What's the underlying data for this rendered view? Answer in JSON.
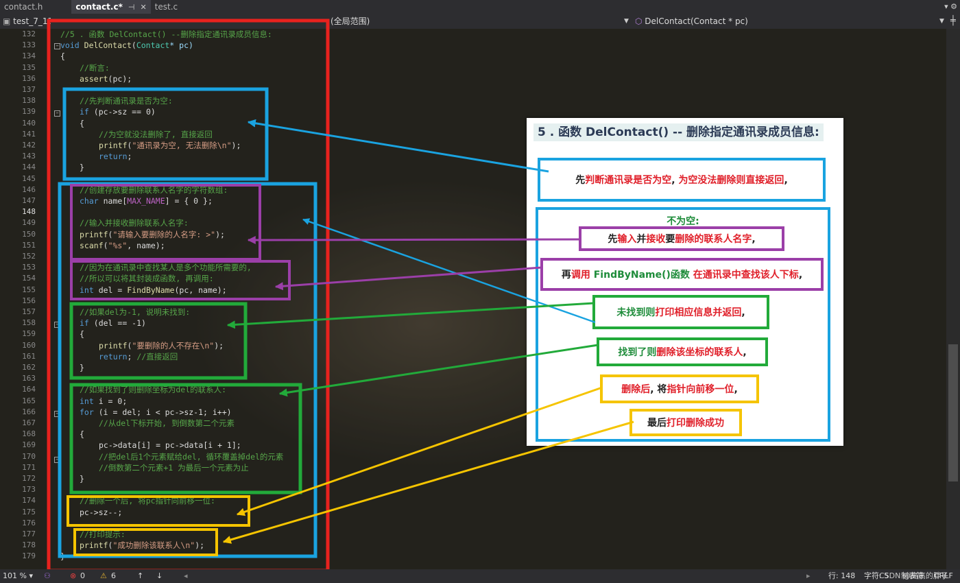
{
  "tabs": [
    {
      "label": "contact.h"
    },
    {
      "label": "contact.c*"
    },
    {
      "label": "test.c"
    }
  ],
  "tab_icons": {
    "pin": "⊣",
    "close": "✕"
  },
  "topright": "▾ ⚙",
  "nav": {
    "project": "test_7_13",
    "scope": "(全局范围)",
    "member": "DelContact(Contact * pc)"
  },
  "line_numbers": [
    "132",
    "133",
    "134",
    "135",
    "136",
    "137",
    "138",
    "139",
    "140",
    "141",
    "142",
    "143",
    "144",
    "145",
    "146",
    "147",
    "148",
    "149",
    "150",
    "151",
    "152",
    "153",
    "154",
    "155",
    "156",
    "157",
    "158",
    "159",
    "160",
    "161",
    "162",
    "163",
    "164",
    "165",
    "166",
    "167",
    "168",
    "169",
    "170",
    "171",
    "172",
    "173",
    "174",
    "175",
    "176",
    "177",
    "178",
    "179"
  ],
  "code": {
    "l132": "//5 . 函数 DelContact() --删除指定通讯录成员信息:",
    "l133_kw": "void",
    "l133_fn": "DelContact",
    "l133_ty": "Contact",
    "l133_rest": "* pc)",
    "l134": "{",
    "l135": "//断言:",
    "l136_fn": "assert",
    "l136_rest": "(pc);",
    "l138": "//先判断通讯录是否为空:",
    "l139_kw": "if",
    "l139_rest": " (pc->sz == 0)",
    "l140": "{",
    "l141": "//为空就没法删除了, 直接返回",
    "l142_fn": "printf",
    "l142_st": "\"通讯录为空, 无法删除\\n\"",
    "l142_end": ");",
    "l143_kw": "return",
    "l143_end": ";",
    "l144": "}",
    "l146": "//创建存放要删除联系人名字的字符数组:",
    "l147_kw": "char",
    "l147_a": " name[",
    "l147_mc": "MAX_NAME",
    "l147_b": "] = { 0 };",
    "l149": "//输入并接收删除联系人名字:",
    "l150_fn": "printf",
    "l150_st": "\"请输入要删除的人名字: >\"",
    "l150_end": ");",
    "l151_fn": "scanf",
    "l151_st": "\"%s\"",
    "l151_end": ", name);",
    "l153": "//因为在通讯录中查找某人是多个功能所需要的,",
    "l154": "//所以可以将其封装成函数, 再调用:",
    "l155_kw": "int",
    "l155_a": " del = ",
    "l155_fn": "FindByName",
    "l155_b": "(pc, name);",
    "l157": "//如果del为-1, 说明未找到:",
    "l158_kw": "if",
    "l158_rest": " (del == -1)",
    "l159": "{",
    "l160_fn": "printf",
    "l160_st": "\"要删除的人不存在\\n\"",
    "l160_end": ");",
    "l161_kw": "return",
    "l161_end": "; ",
    "l161_cm": "//直接返回",
    "l162": "}",
    "l164": "//如果找到了则删除坐标为del的联系人:",
    "l165_kw": "int",
    "l165_rest": " i = 0;",
    "l166_kw": "for",
    "l166_rest": " (i = del; i < pc->sz-1; i++)",
    "l167": "//从del下标开始, 到倒数第二个元素",
    "l168": "{",
    "l169": "pc->data[i] = pc->data[i + 1];",
    "l170": "//把del后1个元素赋给del, 循环覆盖掉del的元素",
    "l171": "//倒数第二个元素+1 为最后一个元素为止",
    "l172": "}",
    "l174": "//删除一个后, 将pc指针向前移一位:",
    "l175": "pc->sz--;",
    "l177": "//打印提示:",
    "l178_fn": "printf",
    "l178_st": "\"成功删除该联系人\\n\"",
    "l178_end": ");",
    "l179": "}"
  },
  "panel": {
    "title": "5 . 函数 DelContact() -- 删除指定通讯录成员信息:",
    "b1": {
      "k1": "先",
      "r1": "判断通讯录是否为空",
      "k2": ", ",
      "r2": "为空没法删除则直接返回",
      "k3": ","
    },
    "b2_title": "不为空:",
    "b3": {
      "k1": "先",
      "r1": "输入",
      "k2": "并",
      "r2": "接收",
      "k3": "要",
      "r3": "删除的联系人名字",
      "k4": ","
    },
    "b4": {
      "k1": "再",
      "r1": "调用 ",
      "g1": "FindByName()函数",
      "r2": " 在通讯录中查找该人下标",
      "k2": ","
    },
    "b5": {
      "g1": "未找到则",
      "r1": "打印相应信息并返回",
      "k1": ","
    },
    "b6": {
      "g1": "找到了则",
      "r1": "删除该坐标的联系人",
      "k1": ","
    },
    "b7": {
      "r1": "删除后",
      "k1": ", 将",
      "r2": "指针向前移一位",
      "k2": ","
    },
    "b8": {
      "k1": "最后",
      "r1": "打印删除成功"
    }
  },
  "status": {
    "zoom": "101 %",
    "errors": "0",
    "warnings": "6",
    "line": "行: 148",
    "char": "字符: 5",
    "tabs": "制表符",
    "eol": "CRLF"
  },
  "watermark": "CSDN @高高的胖子",
  "colors": {
    "red": "#e8221e",
    "blue": "#1aa3e0",
    "purple": "#9b3fa8",
    "green": "#22aa3a",
    "yellow": "#f5c400"
  }
}
